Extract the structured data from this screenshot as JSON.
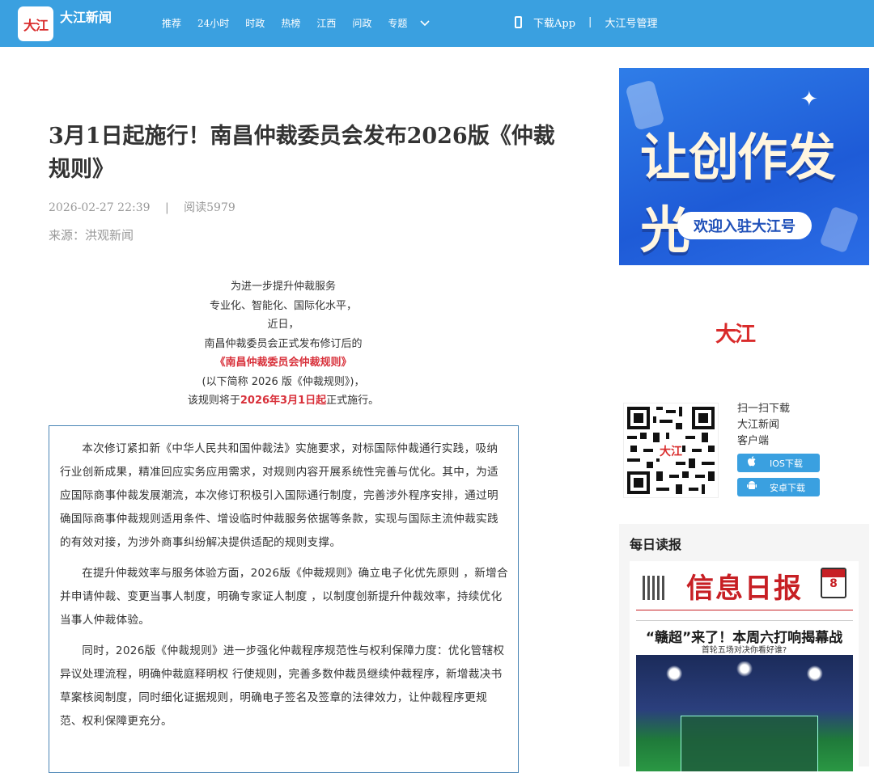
{
  "header": {
    "logo_text": "大江",
    "site_name": "大江新闻",
    "nav": [
      "推荐",
      "24小时",
      "时政",
      "热榜",
      "江西",
      "问政",
      "专题"
    ],
    "download_app": "下载App",
    "separator": "|",
    "account_manage": "大江号管理"
  },
  "article": {
    "title": "3月1日起施行！南昌仲裁委员会发布2026版《仲裁规则》",
    "date": "2026-02-27 22:39",
    "meta_separator": "|",
    "reads": "阅读5979",
    "source": "来源：洪观新闻",
    "intro": {
      "line1": "为进一步提升仲裁服务",
      "line2": "专业化、智能化、国际化水平，",
      "line3": "近日，",
      "line4": "南昌仲裁委员会正式发布修订后的",
      "line5": "《南昌仲裁委员会仲裁规则》",
      "line6": "(以下简称 2026 版《仲裁规则》)，",
      "line7_pre": "该规则将于",
      "line7_red": "2026年3月1日起",
      "line7_post": "正式施行。"
    },
    "paragraphs": [
      "本次修订紧扣新《中华人民共和国仲裁法》实施要求，对标国际仲裁通行实践，吸纳行业创新成果，精准回应实务应用需求，对规则内容开展系统性完善与优化。其中，为适应国际商事仲裁发展潮流，本次修订积极引入国际通行制度，完善涉外程序安排，通过明确国际商事仲裁规则适用条件、增设临时仲裁服务依据等条款，实现与国际主流仲裁实践的有效对接，为涉外商事纠纷解决提供适配的规则支撑。",
      "在提升仲裁效率与服务体验方面，2026版《仲裁规则》确立电子化优先原则 ，新增合并申请仲裁、变更当事人制度，明确专家证人制度 ，以制度创新提升仲裁效率，持续优化当事人仲裁体验。",
      "同时，2026版《仲裁规则》进一步强化仲裁程序规范性与权利保障力度：优化管辖权异议处理流程，明确仲裁庭释明权 行使规则，完善多数仲裁员继续仲裁程序，新增裁决书草案核阅制度，同时细化证据规则，明确电子签名及签章的法律效力，让仲裁程序更规范、权利保障更充分。"
    ]
  },
  "sidebar": {
    "ad": {
      "headline": "让创作发光",
      "button": "欢迎入驻大江号"
    },
    "brand_logo": "大江",
    "scan": {
      "line1": "扫一扫下载",
      "line2": "大江新闻",
      "line3": "客户端"
    },
    "ios_button": "IOS下载",
    "android_button": "安卓下载",
    "daily": {
      "title": "每日读报",
      "paper_name": "信息日报",
      "calendar_day": "8",
      "headline": "“赣超”来了！本周六打响揭幕战",
      "subheadline": "首轮五场对决你看好谁?"
    }
  }
}
